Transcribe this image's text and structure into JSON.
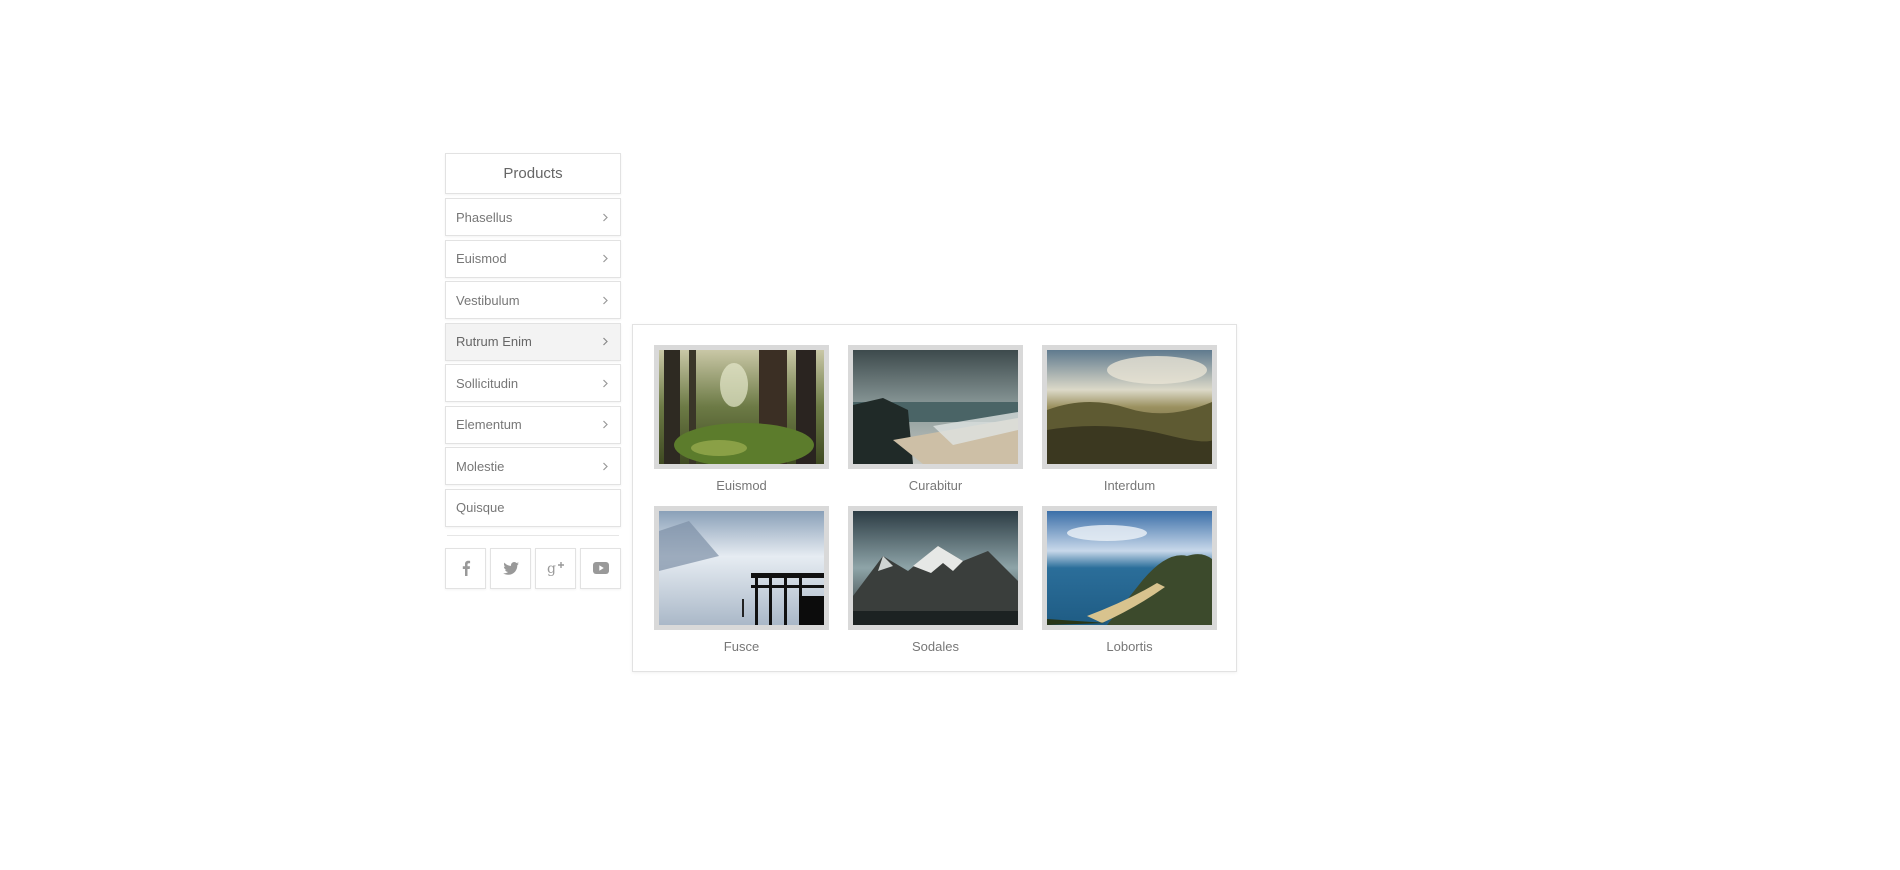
{
  "sidebar": {
    "header": "Products",
    "items": [
      {
        "label": "Phasellus",
        "has_arrow": true
      },
      {
        "label": "Euismod",
        "has_arrow": true
      },
      {
        "label": "Vestibulum",
        "has_arrow": true
      },
      {
        "label": "Rutrum Enim",
        "has_arrow": true,
        "active": true
      },
      {
        "label": "Sollicitudin",
        "has_arrow": true
      },
      {
        "label": "Elementum",
        "has_arrow": true
      },
      {
        "label": "Molestie",
        "has_arrow": true
      },
      {
        "label": "Quisque",
        "has_arrow": false
      }
    ],
    "social": [
      "facebook-icon",
      "twitter-icon",
      "google-plus-icon",
      "youtube-icon"
    ]
  },
  "flyout": {
    "cards": [
      {
        "caption": "Euismod",
        "image": "forest-photo"
      },
      {
        "caption": "Curabitur",
        "image": "beach-cliffs-photo"
      },
      {
        "caption": "Interdum",
        "image": "hills-landscape-photo"
      },
      {
        "caption": "Fusce",
        "image": "misty-pier-photo"
      },
      {
        "caption": "Sodales",
        "image": "snowy-mountain-photo"
      },
      {
        "caption": "Lobortis",
        "image": "coastline-photo"
      }
    ]
  },
  "colors": {
    "border": "#e2e2e2",
    "active_bg": "#f3f3f3",
    "text": "#777777",
    "thumb_frame": "#d9d9d9"
  }
}
